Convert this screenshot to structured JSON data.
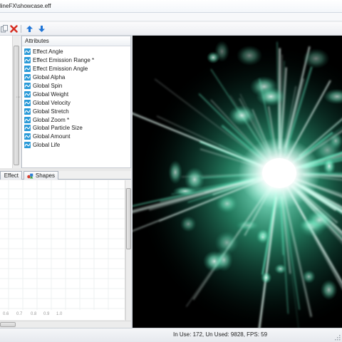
{
  "window": {
    "title": "lineFX\\showcase.eff"
  },
  "toolbar": {
    "buttons": [
      {
        "name": "copy-icon",
        "color": "#8d97a3"
      },
      {
        "name": "delete-icon",
        "color": "#d62a1e"
      },
      {
        "name": "arrow-up-icon",
        "color": "#1f74d6"
      },
      {
        "name": "arrow-down-icon",
        "color": "#1f74d6"
      }
    ]
  },
  "attributes": {
    "header": "Attributes",
    "items": [
      "Effect Angle",
      "Effect Emission Range *",
      "Effect Emission Angle",
      "Global Alpha",
      "Global Spin",
      "Global Weight",
      "Global Velocity",
      "Global Stretch",
      "Global Zoom *",
      "Global Particle Size",
      "Global Amount",
      "Global Life"
    ],
    "icon": "graph-curve-icon",
    "icon_color": "#2a9ad8"
  },
  "tabs": [
    {
      "label": "Effect"
    },
    {
      "label": "Shapes"
    }
  ],
  "graph": {
    "ticks": [
      "0.6",
      "0.7",
      "0.8",
      "0.9",
      "1.0"
    ]
  },
  "preview": {
    "particle_color": "#6fffd3",
    "core_color": "#ffffff"
  },
  "status": {
    "text": "In Use: 172, Un Used: 9828, FPS: 59"
  }
}
